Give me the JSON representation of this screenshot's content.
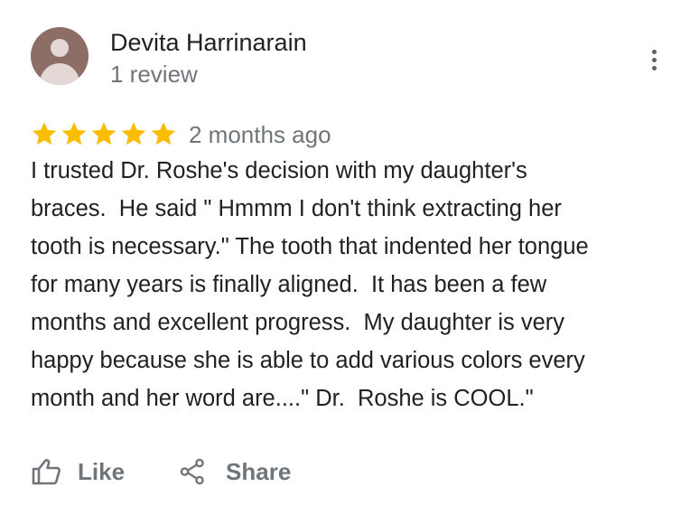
{
  "reviewer": {
    "name": "Devita Harrinarain",
    "review_count": "1 review",
    "avatar_icon": "person-avatar",
    "avatar_color": "#8d6e66"
  },
  "menu": {
    "icon": "more-vert-icon"
  },
  "rating": {
    "stars": 5,
    "max_stars": 5,
    "star_color": "#fbbc04",
    "date": "2 months ago"
  },
  "review": {
    "lines": [
      "I trusted Dr. Roshe's decision with my daughter's",
      "braces.  He said \" Hmmm I don't think extracting her",
      "tooth is necessary.\" The tooth that indented her tongue",
      "for many years is finally aligned.  It has been a few",
      "months and excellent progress.  My daughter is very",
      "happy because she is able to add various colors every",
      "month and her word are....\" Dr.  Roshe is COOL.\""
    ]
  },
  "actions": {
    "like_label": "Like",
    "like_icon": "thumb-up-icon",
    "share_label": "Share",
    "share_icon": "share-icon"
  }
}
